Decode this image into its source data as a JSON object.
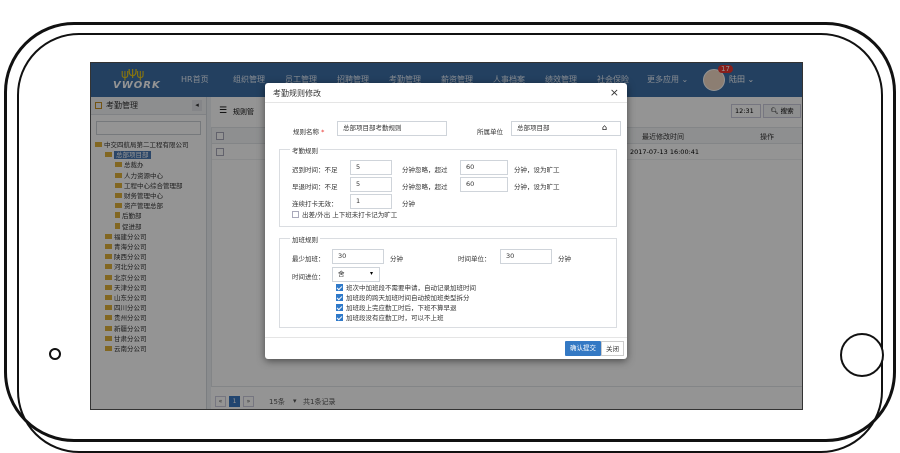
{
  "app": {
    "logo_text": "VWORK",
    "logo_crown": "ψΨψ"
  },
  "nav": [
    "HR首页",
    "组织管理",
    "员工管理",
    "招聘管理",
    "考勤管理",
    "薪资管理",
    "人事档案",
    "绩效管理",
    "社会保险",
    "更多应用 ⌄"
  ],
  "user": {
    "badge": "17",
    "name": "陆田 ⌄"
  },
  "sidebar": {
    "title": "考勤管理",
    "collapse": "◂",
    "tree": [
      {
        "label": "中交四航局第二工程有限公司",
        "level": 0,
        "type": "folder"
      },
      {
        "label": "总部项目部",
        "level": 1,
        "type": "folder",
        "selected": true
      },
      {
        "label": "总裁办",
        "level": 2,
        "type": "folder"
      },
      {
        "label": "人力资源中心",
        "level": 2,
        "type": "folder"
      },
      {
        "label": "工程中心综合管理部",
        "level": 2,
        "type": "folder"
      },
      {
        "label": "财务管理中心",
        "level": 2,
        "type": "folder"
      },
      {
        "label": "资产管理总部",
        "level": 2,
        "type": "folder"
      },
      {
        "label": "后勤部",
        "level": 2,
        "type": "doc"
      },
      {
        "label": "促进部",
        "level": 2,
        "type": "doc"
      },
      {
        "label": "福建分公司",
        "level": 1,
        "type": "folder"
      },
      {
        "label": "青海分公司",
        "level": 1,
        "type": "folder"
      },
      {
        "label": "陕西分公司",
        "level": 1,
        "type": "folder"
      },
      {
        "label": "河北分公司",
        "level": 1,
        "type": "folder"
      },
      {
        "label": "北京分公司",
        "level": 1,
        "type": "folder"
      },
      {
        "label": "天津分公司",
        "level": 1,
        "type": "folder"
      },
      {
        "label": "山东分公司",
        "level": 1,
        "type": "folder"
      },
      {
        "label": "四川分公司",
        "level": 1,
        "type": "folder"
      },
      {
        "label": "贵州分公司",
        "level": 1,
        "type": "folder"
      },
      {
        "label": "新疆分公司",
        "level": 1,
        "type": "folder"
      },
      {
        "label": "甘肃分公司",
        "level": 1,
        "type": "folder"
      },
      {
        "label": "云南分公司",
        "level": 1,
        "type": "folder"
      }
    ]
  },
  "content": {
    "toolbar_label": "规则管",
    "search_time": "12:31",
    "search_button": "搜索",
    "columns": {
      "modified": "最近修改时间",
      "actions": "操作"
    },
    "row": {
      "modified": "2017-07-13 16:00:41"
    },
    "pager": {
      "prev": "«",
      "page": "1",
      "next": "»",
      "size": "15条",
      "total": "共1条记录"
    }
  },
  "modal": {
    "title": "考勤规则修改",
    "close": "×",
    "rule_name_label": "规则名称",
    "rule_name_value": "总部项目部考勤规则",
    "unit_label": "所属单位",
    "unit_value": "总部项目部",
    "attendance_section": "考勤规则",
    "late_label": "迟到时间：不足",
    "late_value": "5",
    "late_mid": "分钟忽略，超过",
    "late_over": "60",
    "late_tail": "分钟，设为旷工",
    "early_label": "早退时间：不足",
    "early_value": "5",
    "early_mid": "分钟忽略，超过",
    "early_over": "60",
    "early_tail": "分钟，设为旷工",
    "consecutive_label": "连续打卡无效：",
    "consecutive_value": "1",
    "consecutive_unit": "分钟",
    "trip_check": "出差/外出 上下班未打卡记为旷工",
    "overtime_section": "加班规则",
    "min_ot_label": "最少加班：",
    "min_ot_value": "30",
    "min_ot_unit": "分钟",
    "unit_time_label": "时间单位：",
    "unit_time_value": "30",
    "unit_time_unit": "分钟",
    "round_label": "时间进位：",
    "round_value": "舍",
    "checks": [
      "班次中加班段不需要申请，自动记录加班时间",
      "加班段的跨天加班时间自动按加班类型拆分",
      "加班段上完应勤工时后，下班不算早退",
      "加班段没有应勤工时，可以不上班"
    ],
    "submit": "确认提交",
    "cancel": "关闭"
  }
}
